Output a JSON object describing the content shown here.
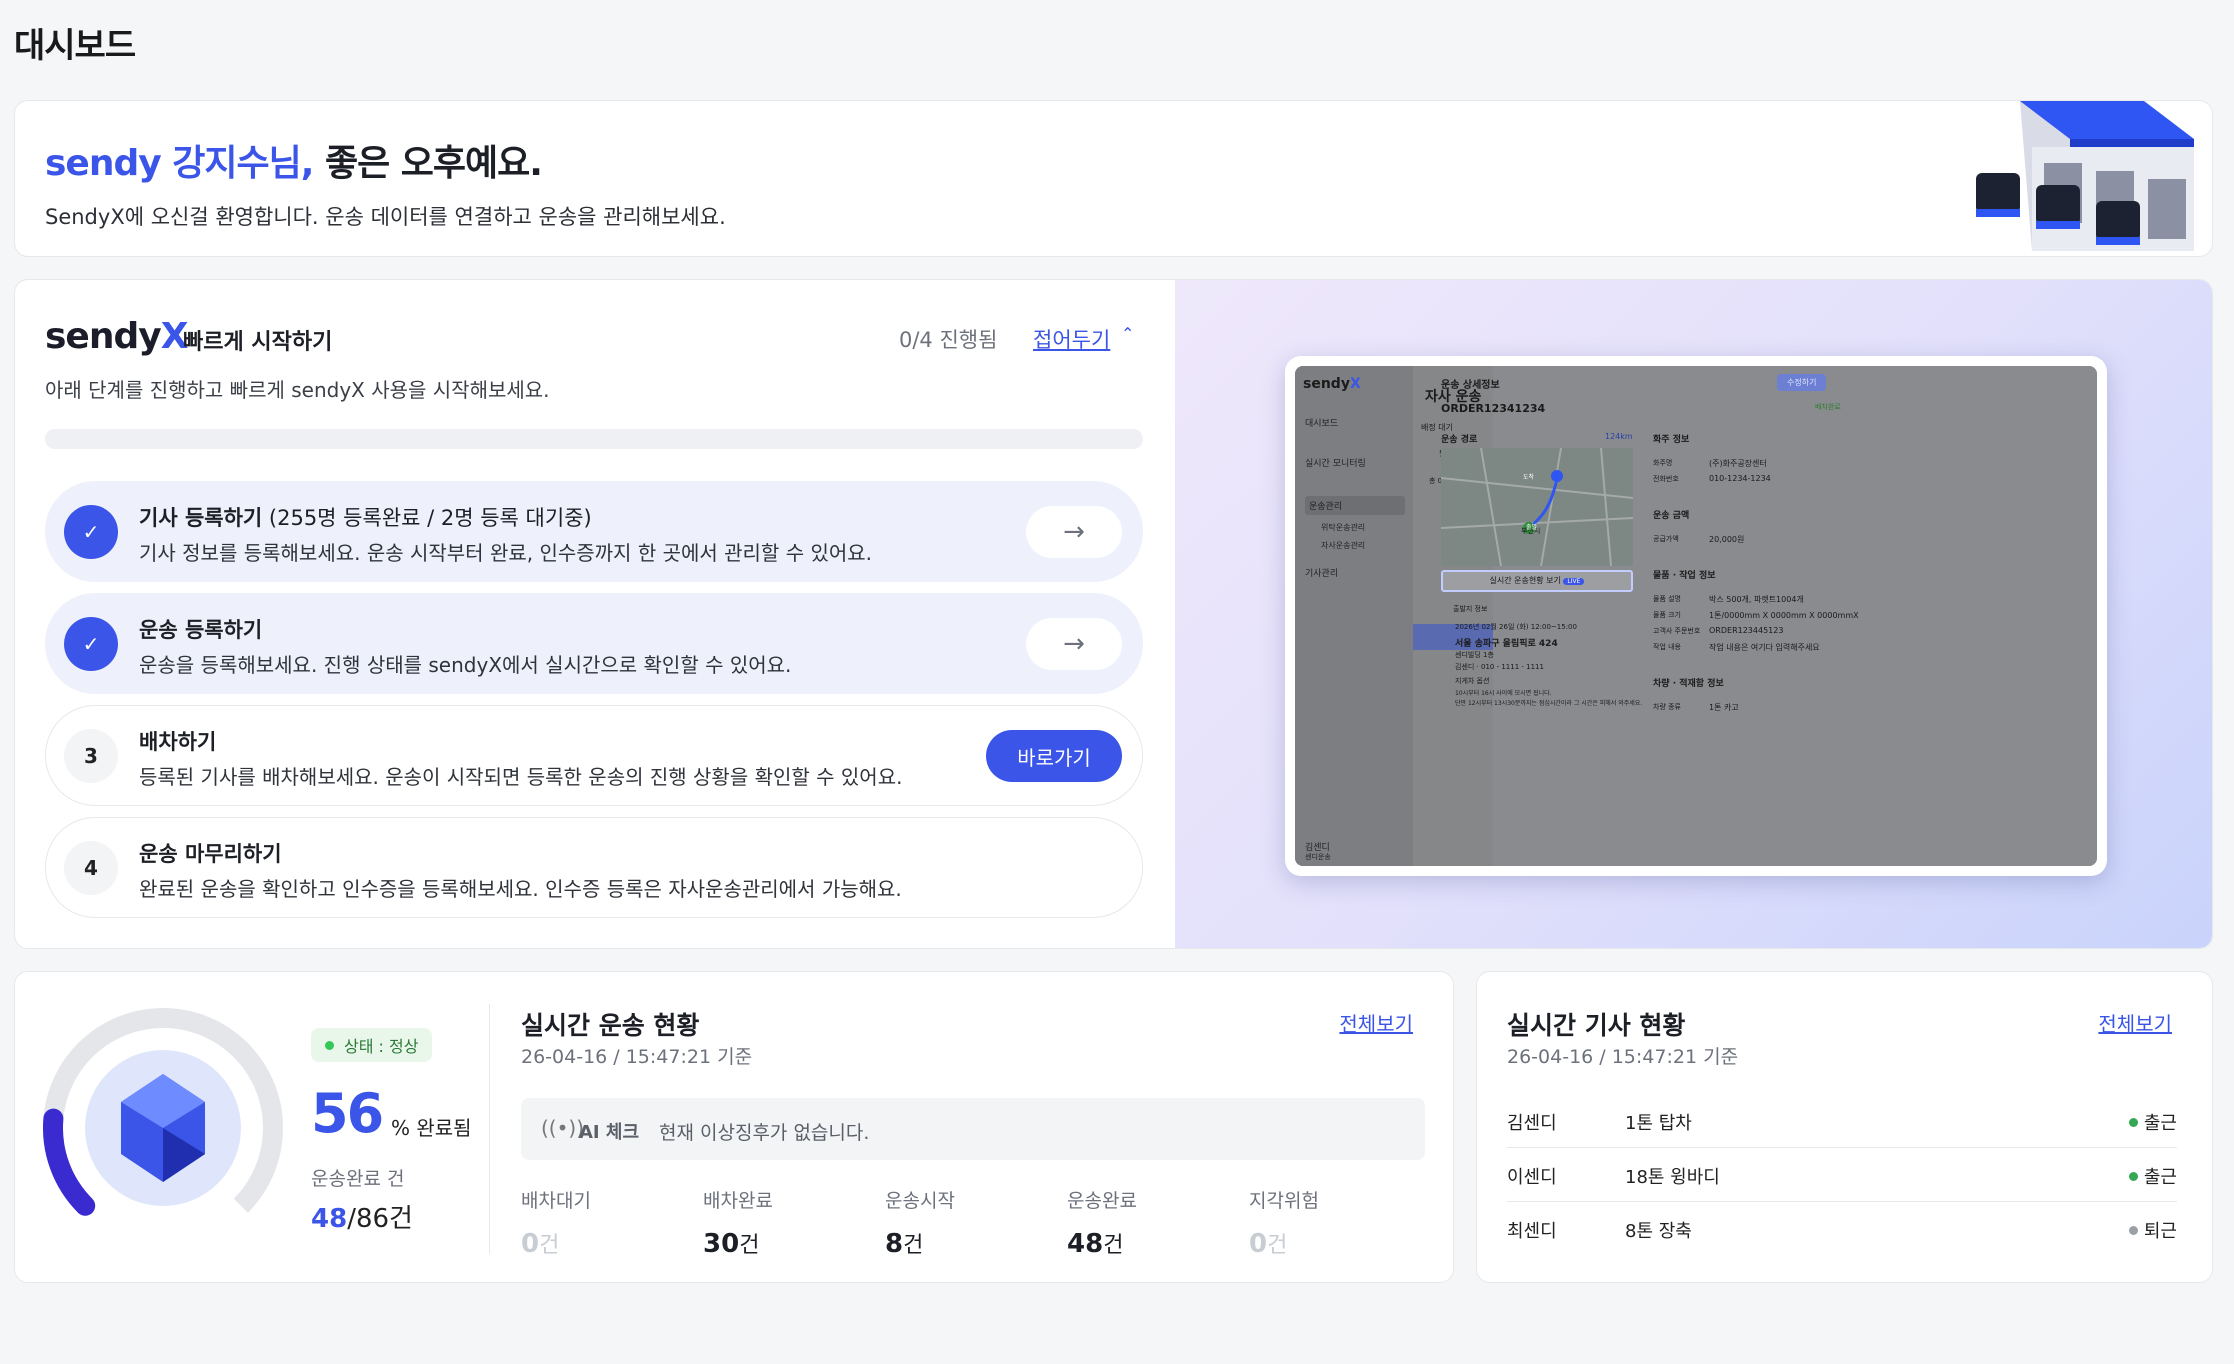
{
  "page": {
    "title": "대시보드"
  },
  "welcome": {
    "name": "sendy 강지수님,",
    "greeting": "좋은 오후예요.",
    "subtitle": "SendyX에 오신걸 환영합니다. 운송 데이터를 연결하고 운송을 관리해보세요."
  },
  "quickstart": {
    "brand_main": "sendy",
    "brand_accent": "X",
    "title": "빠르게 시작하기",
    "progress_label": "0/4 진행됨",
    "collapse_label": "접어두기",
    "description": "아래 단계를 진행하고 빠르게 sendyX 사용을 시작해보세요.",
    "progress": 0,
    "steps": [
      {
        "badge": "✓",
        "title": "기사 등록하기",
        "extra": " (255명 등록완료 / 2명 등록 대기중)",
        "desc": "기사 정보를 등록해보세요. 운송 시작부터 완료, 인수증까지 한 곳에서 관리할 수 있어요.",
        "status": "done"
      },
      {
        "badge": "✓",
        "title": "운송 등록하기",
        "extra": "",
        "desc": "운송을 등록해보세요. 진행 상태를 sendyX에서 실시간으로 확인할 수 있어요.",
        "status": "done"
      },
      {
        "badge": "3",
        "title": "배차하기",
        "extra": "",
        "desc": "등록된 기사를 배차해보세요. 운송이 시작되면 등록한 운송의 진행 상황을 확인할 수 있어요.",
        "status": "todo",
        "button": "바로가기"
      },
      {
        "badge": "4",
        "title": "운송 마무리하기",
        "extra": "",
        "desc": "완료된 운송을 확인하고 인수증을 등록해보세요. 인수증 등록은 자사운송관리에서 가능해요.",
        "status": "todo"
      }
    ]
  },
  "mock": {
    "logo_main": "sendy",
    "logo_accent": "X",
    "nav": [
      "대시보드",
      "실시간 모니터링",
      "운송관리",
      "위탁운송관리",
      "자사운송관리",
      "기사관리"
    ],
    "user_name": "김센디",
    "user_role": "센디운송",
    "col_title": "자사 운송",
    "col_tabs": "배정 대기",
    "filter": "필터",
    "list_count": "총 0개의 검색",
    "panel_title": "운송 상세정보",
    "edit_btn": "수정하기",
    "order_id": "ORDER12341234",
    "order_status": "배차완료",
    "route_label": "운송 경로",
    "route_km": "124km",
    "live_btn": "실시간 운송현황 보기",
    "live_badge": "LIVE",
    "origin_label": "출발지 정보",
    "origin_time": "2026년 02월 26일 (화) 12:00~15:00",
    "origin_addr": "서울 송파구 올림픽로 424",
    "origin_detail": "센디빌딩 1층",
    "origin_phone": "김센디 · 010 - 1111 - 1111",
    "option_label": "지게차 옵션",
    "option_desc1": "10시부터 16시 사이에 모시면 됩니다.",
    "option_desc2": "단만 12시부터 13시30분까지는 점심시간이라 그 시간은 피해서 와주세요.",
    "shipper_label": "화주 정보",
    "shipper_name_k": "화주명",
    "shipper_name_v": "(주)화주공장센터",
    "shipper_phone_k": "전화번호",
    "shipper_phone_v": "010-1234-1234",
    "fare_label": "운송 금액",
    "fare_k": "공급가액",
    "fare_v": "20,000원",
    "goods_label": "물품 · 작업 정보",
    "goods_name_k": "물품 설명",
    "goods_name_v": "박스 500개, 파렛트1004개",
    "goods_size_k": "물품 크기",
    "goods_size_v": "1톤/0000mm X 0000mm X 0000mmX",
    "goods_order_k": "고객사 주문번호",
    "goods_order_v": "ORDER123445123",
    "goods_work_k": "작업 내용",
    "goods_work_v": "작업 내용은 여기다 입력해주세요",
    "vehicle_label": "차량 · 적재함 정보",
    "vehicle_k": "차량 종류",
    "vehicle_v": "1톤 카고",
    "map_origin": "출발",
    "map_dest": "도착",
    "map_city": "부천시",
    "status_chip": "상태"
  },
  "realtime": {
    "status": "상태 : 정상",
    "percent": "56",
    "percent_unit": "% 완료됨",
    "progress": 0.56,
    "done_label": "운송완료 건",
    "done_value": "48",
    "done_total": "/86건",
    "title": "실시간 운송 현황",
    "time": "26-04-16 / 15:47:21 기준",
    "view_all": "전체보기",
    "ai_label": "AI 체크",
    "ai_text": "현재 이상징후가 없습니다.",
    "stats": [
      {
        "label": "배차대기",
        "value": "0",
        "unit": "건",
        "zero": true
      },
      {
        "label": "배차완료",
        "value": "30",
        "unit": "건",
        "zero": false
      },
      {
        "label": "운송시작",
        "value": "8",
        "unit": "건",
        "zero": false
      },
      {
        "label": "운송완료",
        "value": "48",
        "unit": "건",
        "zero": false
      },
      {
        "label": "지각위험",
        "value": "0",
        "unit": "건",
        "zero": true
      }
    ]
  },
  "drivers": {
    "title": "실시간 기사 현황",
    "time": "26-04-16 / 15:47:21 기준",
    "view_all": "전체보기",
    "rows": [
      {
        "name": "김센디",
        "vehicle": "1톤 탑차",
        "state": "출근",
        "color": "#34a853"
      },
      {
        "name": "이센디",
        "vehicle": "18톤 윙바디",
        "state": "출근",
        "color": "#34a853"
      },
      {
        "name": "최센디",
        "vehicle": "8톤 장축",
        "state": "퇴근",
        "color": "#9aa0a6"
      }
    ]
  },
  "colors": {
    "accent": "#3a55e8",
    "ok": "#34c759",
    "donut": "#3a2bd1"
  }
}
